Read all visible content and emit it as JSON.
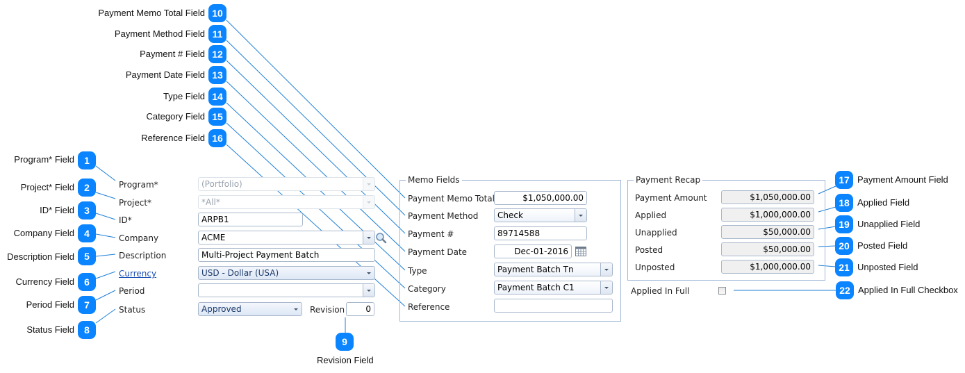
{
  "callouts": {
    "left": [
      {
        "num": "1",
        "text": "Program* Field"
      },
      {
        "num": "2",
        "text": "Project* Field"
      },
      {
        "num": "3",
        "text": "ID* Field"
      },
      {
        "num": "4",
        "text": "Company Field"
      },
      {
        "num": "5",
        "text": "Description Field"
      },
      {
        "num": "6",
        "text": "Currency Field"
      },
      {
        "num": "7",
        "text": "Period Field"
      },
      {
        "num": "8",
        "text": "Status Field"
      }
    ],
    "revision": {
      "num": "9",
      "text": "Revision Field"
    },
    "top": [
      {
        "num": "10",
        "text": "Payment Memo Total Field"
      },
      {
        "num": "11",
        "text": "Payment Method Field"
      },
      {
        "num": "12",
        "text": "Payment # Field"
      },
      {
        "num": "13",
        "text": "Payment Date Field"
      },
      {
        "num": "14",
        "text": "Type Field"
      },
      {
        "num": "15",
        "text": "Category Field"
      },
      {
        "num": "16",
        "text": "Reference Field"
      }
    ],
    "right": [
      {
        "num": "17",
        "text": "Payment Amount Field"
      },
      {
        "num": "18",
        "text": "Applied Field"
      },
      {
        "num": "19",
        "text": "Unapplied Field"
      },
      {
        "num": "20",
        "text": "Posted Field"
      },
      {
        "num": "21",
        "text": "Unposted Field"
      },
      {
        "num": "22",
        "text": "Applied In Full Checkbox"
      }
    ]
  },
  "form": {
    "program": {
      "label": "Program*",
      "value": "(Portfolio)"
    },
    "project": {
      "label": "Project*",
      "value": "*All*"
    },
    "id": {
      "label": "ID*",
      "value": "ARPB1"
    },
    "company": {
      "label": "Company",
      "value": "ACME"
    },
    "description": {
      "label": "Description",
      "value": "Multi-Project Payment Batch"
    },
    "currency": {
      "label": "Currency",
      "value": "USD - Dollar (USA)"
    },
    "period": {
      "label": "Period",
      "value": ""
    },
    "status": {
      "label": "Status",
      "value": "Approved"
    },
    "revision": {
      "label": "Revision",
      "value": "0"
    }
  },
  "memo": {
    "title": "Memo Fields",
    "payment_memo_total": {
      "label": "Payment Memo Total",
      "value": "$1,050,000.00"
    },
    "payment_method": {
      "label": "Payment Method",
      "value": "Check"
    },
    "payment_number": {
      "label": "Payment #",
      "value": "89714588"
    },
    "payment_date": {
      "label": "Payment Date",
      "value": "Dec-01-2016"
    },
    "type": {
      "label": "Type",
      "value": "Payment Batch Tn"
    },
    "category": {
      "label": "Category",
      "value": "Payment Batch C1"
    },
    "reference": {
      "label": "Reference",
      "value": ""
    }
  },
  "recap": {
    "title": "Payment Recap",
    "payment_amount": {
      "label": "Payment Amount",
      "value": "$1,050,000.00"
    },
    "applied": {
      "label": "Applied",
      "value": "$1,000,000.00"
    },
    "unapplied": {
      "label": "Unapplied",
      "value": "$50,000.00"
    },
    "posted": {
      "label": "Posted",
      "value": "$50,000.00"
    },
    "unposted": {
      "label": "Unposted",
      "value": "$1,000,000.00"
    },
    "applied_in_full": {
      "label": "Applied In Full",
      "checked": false
    }
  },
  "colors": {
    "badge": "#0a84ff",
    "callout_line": "#1e7fd6",
    "group_border": "#9fb7d6"
  }
}
